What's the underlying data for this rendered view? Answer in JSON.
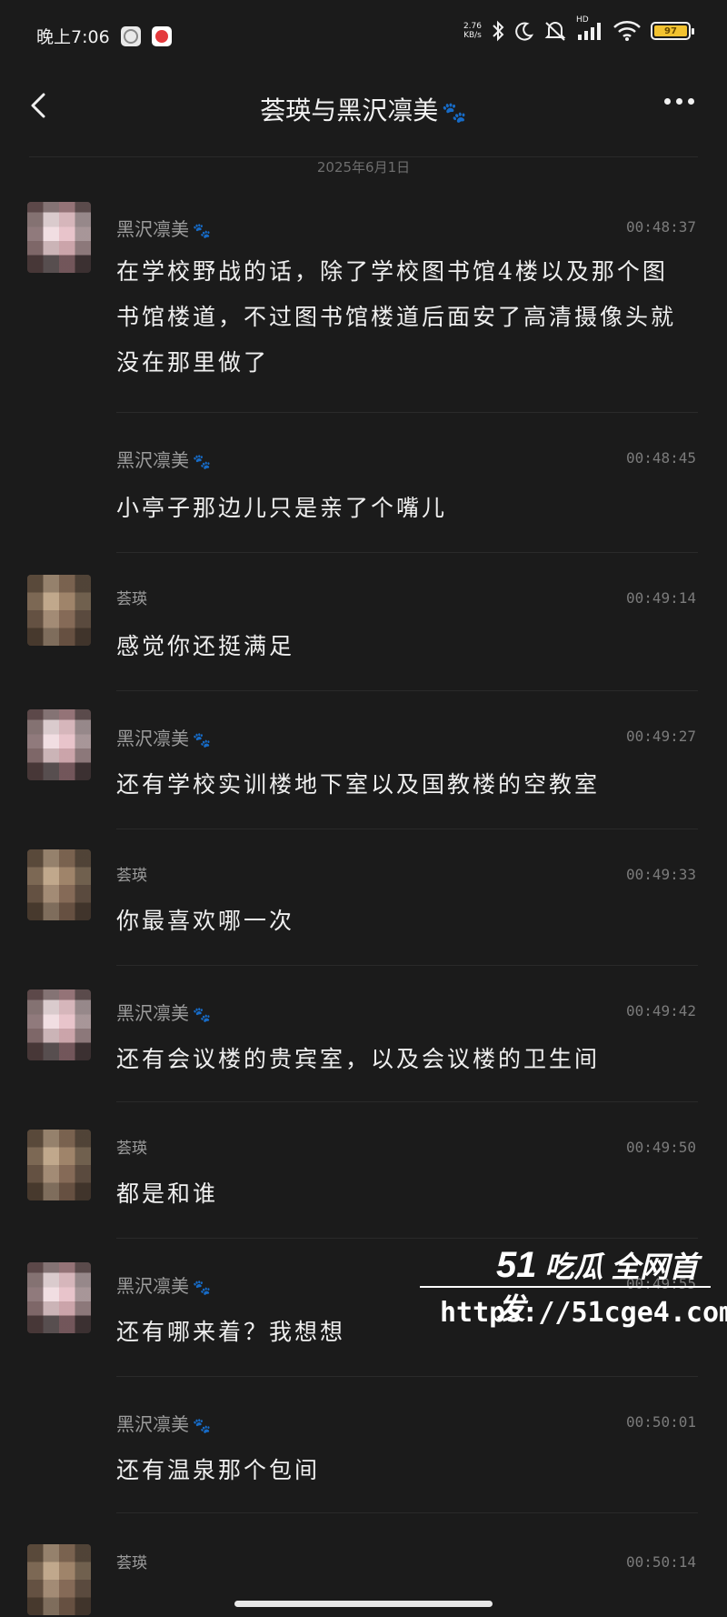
{
  "status_bar": {
    "time": "晚上7:06",
    "net_speed_value": "2.76",
    "net_speed_unit": "KB/s",
    "signal_label": "HD",
    "battery_level": "97",
    "icons": [
      "app-icon",
      "record-icon",
      "bluetooth-icon",
      "moon-icon",
      "mute-icon",
      "signal-icon",
      "wifi-icon",
      "battery-icon"
    ]
  },
  "header": {
    "title": "荟瑛与黑沢凛美",
    "title_decoration": "🐾",
    "back_icon": "chevron-left-icon",
    "more_icon": "more-dots-icon"
  },
  "date_separator": "2025年6月1日",
  "messages": [
    {
      "sender": "黑沢凛美",
      "time": "00:48:37",
      "text": "在学校野战的话，除了学校图书馆4楼以及那个图书馆楼道，不过图书馆楼道后面安了高清摄像头就没在那里做了"
    },
    {
      "sender": "黑沢凛美",
      "time": "00:48:45",
      "text": "小亭子那边儿只是亲了个嘴儿"
    },
    {
      "sender": "荟瑛",
      "time": "00:49:14",
      "text": "感觉你还挺满足"
    },
    {
      "sender": "黑沢凛美",
      "time": "00:49:27",
      "text": "还有学校实训楼地下室以及国教楼的空教室"
    },
    {
      "sender": "荟瑛",
      "time": "00:49:33",
      "text": "你最喜欢哪一次"
    },
    {
      "sender": "黑沢凛美",
      "time": "00:49:42",
      "text": "还有会议楼的贵宾室，以及会议楼的卫生间"
    },
    {
      "sender": "荟瑛",
      "time": "00:49:50",
      "text": "都是和谁"
    },
    {
      "sender": "黑沢凛美",
      "time": "00:49:55",
      "text": "还有哪来着？我想想"
    },
    {
      "sender": "黑沢凛美",
      "time": "00:50:01",
      "text": "还有温泉那个包间"
    },
    {
      "sender": "荟瑛",
      "time": "00:50:14",
      "text": ""
    }
  ],
  "name_decoration": "🐾",
  "watermark": {
    "brand_number": "51",
    "brand_text": "吃瓜 全网首发",
    "url": "https://51cge4.com"
  }
}
